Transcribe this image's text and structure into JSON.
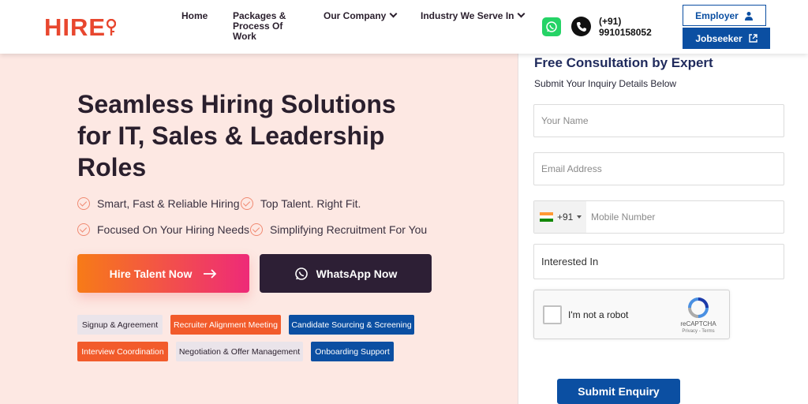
{
  "brand": {
    "logo_text": "HIRE"
  },
  "nav": {
    "home": "Home",
    "packages": [
      "Packages &",
      "Process Of",
      "Work"
    ],
    "company": "Our Company",
    "industry": "Industry We Serve In"
  },
  "contact": {
    "phone_line1": "(+91)",
    "phone_line2": "9910158052"
  },
  "header_buttons": {
    "employer": "Employer",
    "jobseeker": "Jobseeker"
  },
  "hero": {
    "headline": [
      "Seamless Hiring Solutions",
      "for IT, Sales & Leadership",
      "Roles"
    ],
    "features": [
      "Smart, Fast & Reliable Hiring",
      "Top Talent. Right Fit.",
      "Focused On Your Hiring Needs",
      "Simplifying Recruitment For You"
    ],
    "cta_hire": "Hire Talent Now",
    "cta_whatsapp": "WhatsApp Now"
  },
  "process_tags": [
    "Signup & Agreement",
    "Recruiter Alignment Meeting",
    "Candidate Sourcing & Screening",
    "Interview Coordination",
    "Negotiation & Offer Management",
    "Onboarding Support"
  ],
  "form": {
    "title": "Free Consultation by Expert",
    "subtitle": "Submit Your Inquiry Details Below",
    "name_placeholder": "Your Name",
    "email_placeholder": "Email Address",
    "country_code": "+91",
    "mobile_placeholder": "Mobile Number",
    "interest_select": "Interested In",
    "captcha_label": "I'm not a robot",
    "captcha_brand": "reCAPTCHA",
    "captcha_links": "Privacy - Terms",
    "submit": "Submit Enquiry"
  },
  "colors": {
    "accent_orange": "#f25b2b",
    "brand_blue": "#0b4fa2",
    "dark_purple": "#2d1f35",
    "hero_bg": "#fde8e3"
  }
}
